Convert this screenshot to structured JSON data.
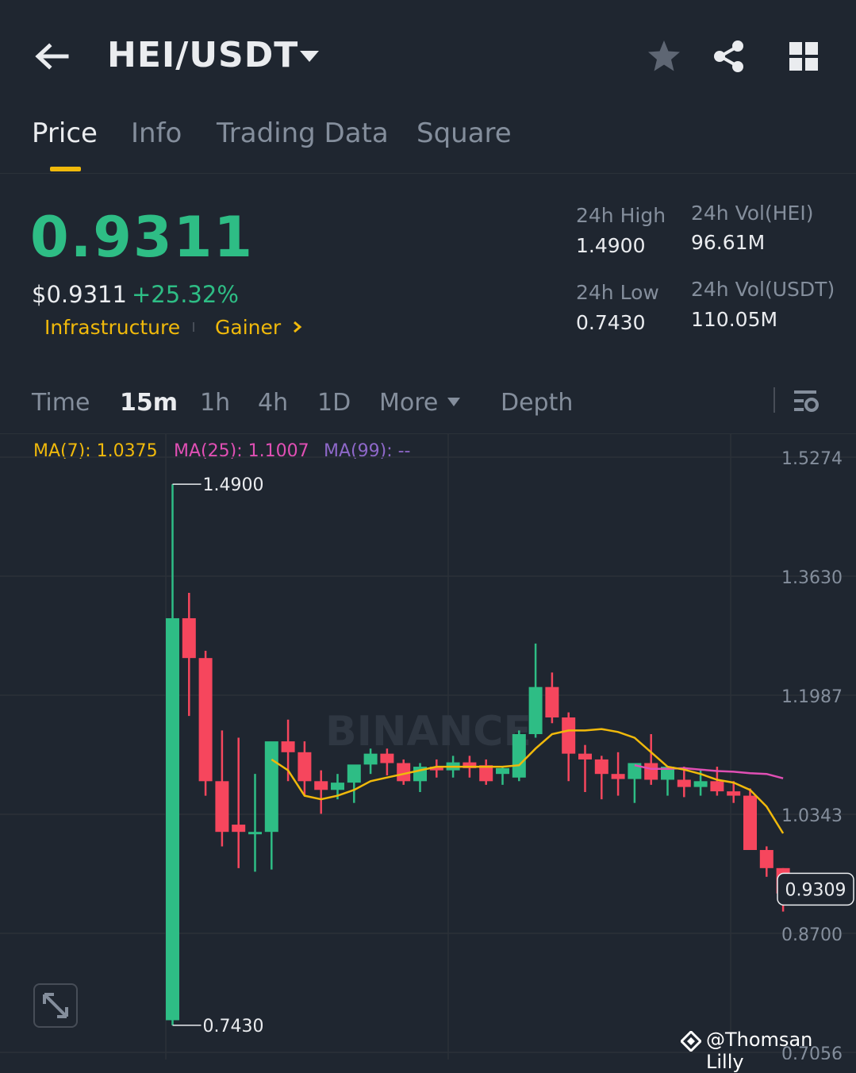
{
  "header": {
    "pair": "HEI/USDT",
    "back_icon": "arrow-left-icon",
    "favorite_icon": "star-icon",
    "share_icon": "share-icon",
    "menu_icon": "grid-icon"
  },
  "tabs": [
    {
      "label": "Price",
      "active": true
    },
    {
      "label": "Info",
      "active": false
    },
    {
      "label": "Trading Data",
      "active": false
    },
    {
      "label": "Square",
      "active": false
    }
  ],
  "ticker": {
    "last_price": "0.9311",
    "usd_price": "$0.9311",
    "change_pct": "+25.32%",
    "tags": [
      "Infrastructure",
      "Gainer"
    ],
    "stats": {
      "high_label": "24h High",
      "high_value": "1.4900",
      "low_label": "24h Low",
      "low_value": "0.7430",
      "vol_base_label": "24h Vol(HEI)",
      "vol_base_value": "96.61M",
      "vol_quote_label": "24h Vol(USDT)",
      "vol_quote_value": "110.05M"
    }
  },
  "timeframes": {
    "items": [
      "Time",
      "15m",
      "1h",
      "4h",
      "1D",
      "More",
      "Depth"
    ],
    "active": "15m"
  },
  "indicators": {
    "ma7": "MA(7): 1.0375",
    "ma25": "MA(25): 1.1007",
    "ma99": "MA(99): --"
  },
  "colors": {
    "up": "#2ebd85",
    "down": "#f6465d",
    "accent": "#f0b90b",
    "ma7": "#f0b90b",
    "ma25": "#e04fb4",
    "ma99": "#8e68c9"
  },
  "chart_data": {
    "type": "candlestick",
    "interval": "15m",
    "y_ticks": [
      "1.5274",
      "1.3630",
      "1.1987",
      "1.0343",
      "0.8700",
      "0.7056"
    ],
    "ylim": [
      0.7056,
      1.5274
    ],
    "high_marker": "1.4900",
    "low_marker": "0.7430",
    "current_price_label": "0.9309",
    "watermark": "BINANCE",
    "candles": [
      {
        "o": 0.75,
        "h": 1.49,
        "l": 0.743,
        "c": 1.305
      },
      {
        "o": 1.305,
        "h": 1.34,
        "l": 1.17,
        "c": 1.25
      },
      {
        "o": 1.25,
        "h": 1.26,
        "l": 1.06,
        "c": 1.08
      },
      {
        "o": 1.08,
        "h": 1.15,
        "l": 0.99,
        "c": 1.01
      },
      {
        "o": 1.02,
        "h": 1.14,
        "l": 0.96,
        "c": 1.01
      },
      {
        "o": 1.01,
        "h": 1.09,
        "l": 0.955,
        "c": 1.01
      },
      {
        "o": 1.01,
        "h": 1.13,
        "l": 0.958,
        "c": 1.135
      },
      {
        "o": 1.135,
        "h": 1.165,
        "l": 1.08,
        "c": 1.12
      },
      {
        "o": 1.12,
        "h": 1.135,
        "l": 1.06,
        "c": 1.08
      },
      {
        "o": 1.08,
        "h": 1.095,
        "l": 1.035,
        "c": 1.068
      },
      {
        "o": 1.068,
        "h": 1.09,
        "l": 1.055,
        "c": 1.078
      },
      {
        "o": 1.078,
        "h": 1.1,
        "l": 1.05,
        "c": 1.103
      },
      {
        "o": 1.103,
        "h": 1.125,
        "l": 1.09,
        "c": 1.118
      },
      {
        "o": 1.118,
        "h": 1.125,
        "l": 1.088,
        "c": 1.105
      },
      {
        "o": 1.105,
        "h": 1.11,
        "l": 1.075,
        "c": 1.08
      },
      {
        "o": 1.08,
        "h": 1.105,
        "l": 1.065,
        "c": 1.1
      },
      {
        "o": 1.1,
        "h": 1.11,
        "l": 1.085,
        "c": 1.095
      },
      {
        "o": 1.095,
        "h": 1.115,
        "l": 1.085,
        "c": 1.106
      },
      {
        "o": 1.106,
        "h": 1.115,
        "l": 1.085,
        "c": 1.098
      },
      {
        "o": 1.102,
        "h": 1.11,
        "l": 1.075,
        "c": 1.08
      },
      {
        "o": 1.09,
        "h": 1.1,
        "l": 1.075,
        "c": 1.098
      },
      {
        "o": 1.085,
        "h": 1.15,
        "l": 1.08,
        "c": 1.145
      },
      {
        "o": 1.145,
        "h": 1.27,
        "l": 1.14,
        "c": 1.21
      },
      {
        "o": 1.21,
        "h": 1.23,
        "l": 1.16,
        "c": 1.168
      },
      {
        "o": 1.168,
        "h": 1.175,
        "l": 1.08,
        "c": 1.118
      },
      {
        "o": 1.118,
        "h": 1.13,
        "l": 1.065,
        "c": 1.11
      },
      {
        "o": 1.11,
        "h": 1.115,
        "l": 1.055,
        "c": 1.09
      },
      {
        "o": 1.09,
        "h": 1.12,
        "l": 1.06,
        "c": 1.083
      },
      {
        "o": 1.083,
        "h": 1.1,
        "l": 1.05,
        "c": 1.105
      },
      {
        "o": 1.105,
        "h": 1.145,
        "l": 1.075,
        "c": 1.082
      },
      {
        "o": 1.082,
        "h": 1.1,
        "l": 1.06,
        "c": 1.1
      },
      {
        "o": 1.082,
        "h": 1.1,
        "l": 1.058,
        "c": 1.072
      },
      {
        "o": 1.072,
        "h": 1.095,
        "l": 1.06,
        "c": 1.08
      },
      {
        "o": 1.08,
        "h": 1.1,
        "l": 1.06,
        "c": 1.066
      },
      {
        "o": 1.066,
        "h": 1.08,
        "l": 1.05,
        "c": 1.06
      },
      {
        "o": 1.06,
        "h": 1.07,
        "l": 1.03,
        "c": 0.985
      },
      {
        "o": 0.985,
        "h": 0.99,
        "l": 0.948,
        "c": 0.96
      },
      {
        "o": 0.96,
        "h": 0.96,
        "l": 0.9,
        "c": 0.925
      }
    ],
    "ma7_series": [
      null,
      null,
      null,
      null,
      null,
      null,
      1.11,
      1.095,
      1.06,
      1.055,
      1.06,
      1.068,
      1.08,
      1.085,
      1.09,
      1.095,
      1.1,
      1.1,
      1.1,
      1.1,
      1.1,
      1.102,
      1.125,
      1.145,
      1.15,
      1.15,
      1.152,
      1.148,
      1.14,
      1.12,
      1.1,
      1.096,
      1.09,
      1.082,
      1.078,
      1.068,
      1.045,
      1.008
    ],
    "ma25_series": [
      null,
      null,
      null,
      null,
      null,
      null,
      null,
      null,
      null,
      null,
      null,
      null,
      null,
      null,
      null,
      null,
      null,
      null,
      null,
      null,
      null,
      null,
      null,
      null,
      null,
      null,
      null,
      null,
      1.102,
      1.097,
      1.097,
      1.098,
      1.096,
      1.094,
      1.093,
      1.091,
      1.09,
      1.084
    ]
  },
  "footer": {
    "credit": "@Thomsan Lilly",
    "expand_icon": "expand-icon"
  }
}
